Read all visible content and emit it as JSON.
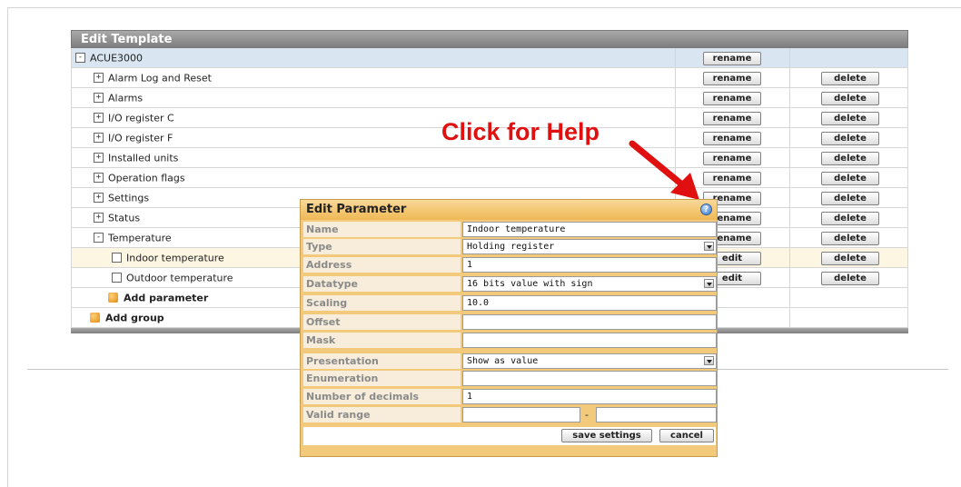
{
  "template": {
    "title": "Edit Template",
    "root": {
      "label": "ACUE3000",
      "toggle": "-",
      "rename": "rename"
    },
    "groups": [
      {
        "label": "Alarm Log and Reset",
        "toggle": "+",
        "rename": "rename",
        "delete": "delete"
      },
      {
        "label": "Alarms",
        "toggle": "+",
        "rename": "rename",
        "delete": "delete"
      },
      {
        "label": "I/O register C",
        "toggle": "+",
        "rename": "rename",
        "delete": "delete"
      },
      {
        "label": "I/O register F",
        "toggle": "+",
        "rename": "rename",
        "delete": "delete"
      },
      {
        "label": "Installed units",
        "toggle": "+",
        "rename": "rename",
        "delete": "delete"
      },
      {
        "label": "Operation flags",
        "toggle": "+",
        "rename": "rename",
        "delete": "delete"
      },
      {
        "label": "Settings",
        "toggle": "+",
        "rename": "rename",
        "delete": "delete"
      },
      {
        "label": "Status",
        "toggle": "+",
        "rename": "rename",
        "delete": "delete"
      },
      {
        "label": "Temperature",
        "toggle": "-",
        "rename": "rename",
        "delete": "delete"
      }
    ],
    "params": [
      {
        "label": "Indoor temperature",
        "edit": "edit",
        "delete": "delete"
      },
      {
        "label": "Outdoor temperature",
        "edit": "edit",
        "delete": "delete"
      }
    ],
    "add_parameter": "Add parameter",
    "add_group": "Add group"
  },
  "help_callout": "Click for Help",
  "dialog": {
    "title": "Edit Parameter",
    "help_icon": "?",
    "fields": {
      "name": {
        "label": "Name",
        "value": "Indoor temperature"
      },
      "type": {
        "label": "Type",
        "value": "Holding register"
      },
      "address": {
        "label": "Address",
        "value": "1"
      },
      "datatype": {
        "label": "Datatype",
        "value": "16 bits value with sign"
      },
      "scaling": {
        "label": "Scaling",
        "value": "10.0"
      },
      "offset": {
        "label": "Offset",
        "value": ""
      },
      "mask": {
        "label": "Mask",
        "value": ""
      },
      "presentation": {
        "label": "Presentation",
        "value": "Show as value"
      },
      "enumeration": {
        "label": "Enumeration",
        "value": ""
      },
      "decimals": {
        "label": "Number of decimals",
        "value": "1"
      },
      "valid_range": {
        "label": "Valid range",
        "separator": "-"
      }
    },
    "save_label": "save settings",
    "cancel_label": "cancel"
  },
  "colors": {
    "help_text": "#e01010",
    "dialog_bg": "#f3c97c",
    "root_row": "#d9e6f2"
  }
}
